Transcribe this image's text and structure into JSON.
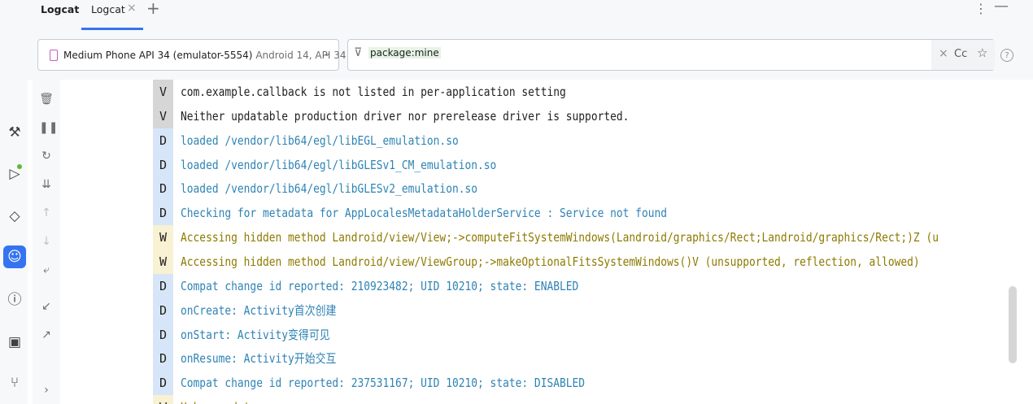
{
  "toolwindow": {
    "title": "Logcat",
    "tab": {
      "label": "Logcat",
      "close": "×"
    },
    "add": "+",
    "more": "⋮",
    "minimize": "—"
  },
  "filterbar": {
    "device": {
      "name": "Medium Phone API 34 (emulator-5554)",
      "meta": "Android 14, API 34"
    },
    "query": "package:mine",
    "case_label": "Cc"
  },
  "rail": {
    "icons": [
      "hammer-icon",
      "run-icon",
      "gem-icon",
      "logcat-icon",
      "problems-icon",
      "terminal-icon",
      "git-icon"
    ]
  },
  "tools": {
    "icons": [
      "trash-icon",
      "pause-icon",
      "restart-icon",
      "scroll-end-icon",
      "up-icon",
      "down-icon",
      "soft-wrap-icon",
      "collapse-icon",
      "expand-icon"
    ]
  },
  "log": {
    "rows": [
      {
        "level": "V",
        "message": "com.example.callback is not listed in per-application setting"
      },
      {
        "level": "V",
        "message": "Neither updatable production driver nor prerelease driver is supported."
      },
      {
        "level": "D",
        "message": "loaded /vendor/lib64/egl/libEGL_emulation.so"
      },
      {
        "level": "D",
        "message": "loaded /vendor/lib64/egl/libGLESv1_CM_emulation.so"
      },
      {
        "level": "D",
        "message": "loaded /vendor/lib64/egl/libGLESv2_emulation.so"
      },
      {
        "level": "D",
        "message": "Checking for metadata for AppLocalesMetadataHolderService : Service not found"
      },
      {
        "level": "W",
        "message": "Accessing hidden method Landroid/view/View;->computeFitSystemWindows(Landroid/graphics/Rect;Landroid/graphics/Rect;)Z (u"
      },
      {
        "level": "W",
        "message": "Accessing hidden method Landroid/view/ViewGroup;->makeOptionalFitsSystemWindows()V (unsupported, reflection, allowed)"
      },
      {
        "level": "D",
        "message": "Compat change id reported: 210923482; UID 10210; state: ENABLED"
      },
      {
        "level": "D",
        "message": "onCreate: Activity首次创建"
      },
      {
        "level": "D",
        "message": "onStart: Activity变得可见"
      },
      {
        "level": "D",
        "message": "onResume: Activity开始交互"
      },
      {
        "level": "D",
        "message": "Compat change id reported: 237531167; UID 10210; state: DISABLED"
      },
      {
        "level": "W",
        "message": "Unknown data   s..."
      }
    ]
  },
  "colors": {
    "accent": "#3574f0",
    "debug": "#2f83b4",
    "warn": "#8e7a00"
  }
}
